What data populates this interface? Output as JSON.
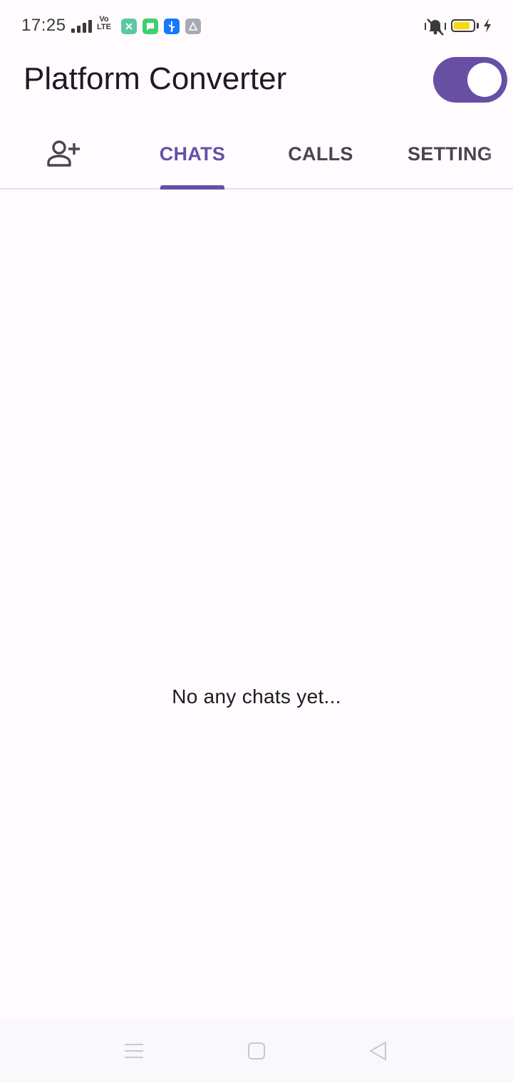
{
  "status_bar": {
    "time": "17:25",
    "volte_top": "Vo",
    "volte_bottom": "LTE",
    "battery_level": 0.85,
    "battery_color": "#f7d90e",
    "notification_icons": [
      {
        "name": "app-icon-green",
        "color": "#5bc8a0"
      },
      {
        "name": "message-icon",
        "color": "#3fcf6e"
      },
      {
        "name": "usb-icon",
        "color": "#1677ff"
      },
      {
        "name": "app-icon-gray",
        "color": "#a5aab3"
      }
    ]
  },
  "app_bar": {
    "title": "Platform Converter",
    "switch_on": true,
    "accent_color": "#6750a4"
  },
  "tabs": {
    "add_contact_icon": "person-add-icon",
    "items": [
      {
        "label": "CHATS",
        "active": true
      },
      {
        "label": "CALLS",
        "active": false
      },
      {
        "label": "SETTING",
        "active": false
      }
    ]
  },
  "main": {
    "empty_message": "No any chats yet..."
  },
  "nav_bar": {
    "icons": [
      "menu-icon",
      "home-icon",
      "back-icon"
    ]
  }
}
